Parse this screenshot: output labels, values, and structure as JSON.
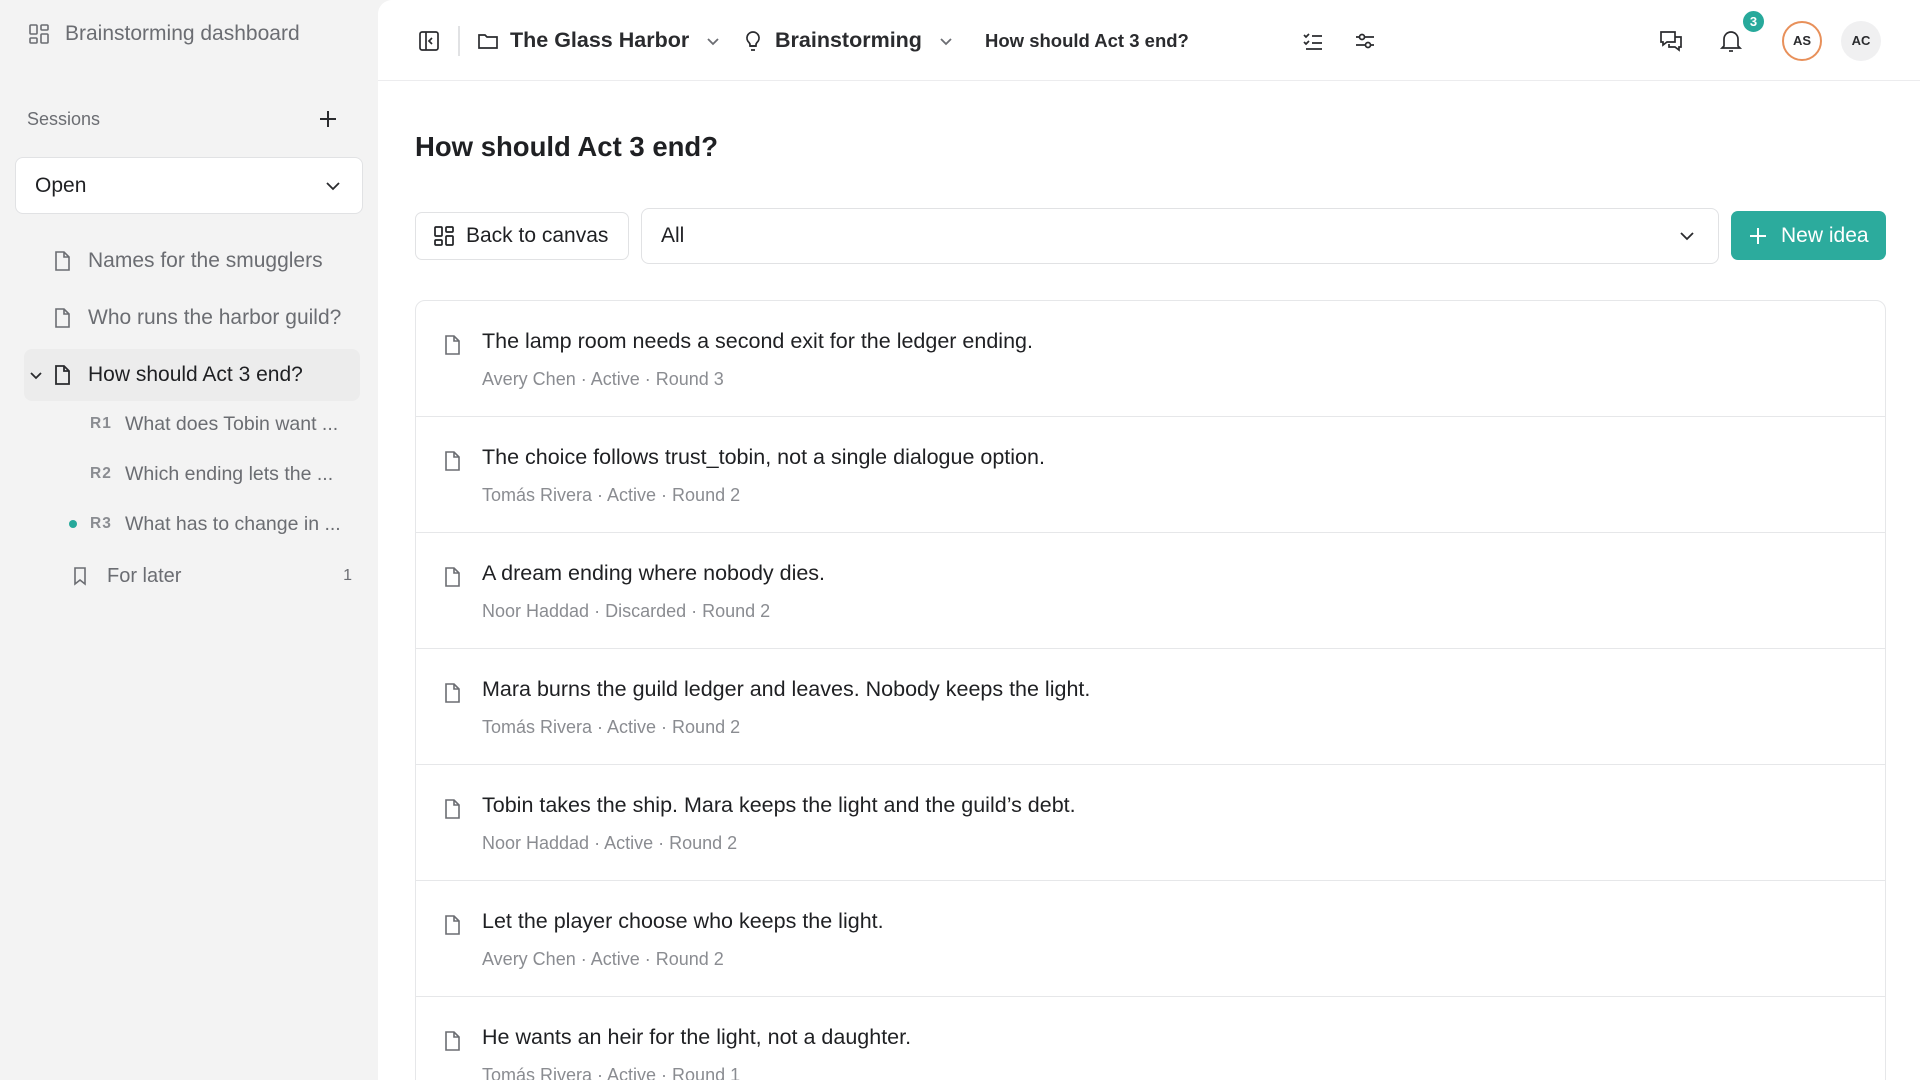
{
  "sidebar": {
    "brand": "Brainstorming dashboard",
    "sessions_label": "Sessions",
    "filter_value": "Open",
    "sessions": [
      {
        "label": "Names for the smugglers"
      },
      {
        "label": "Who runs the harbor guild?"
      },
      {
        "label": "How should Act 3 end?"
      }
    ],
    "rounds": [
      {
        "code": "R1",
        "label": "What does Tobin want ..."
      },
      {
        "code": "R2",
        "label": "Which ending lets the ..."
      },
      {
        "code": "R3",
        "label": "What has to change in ..."
      }
    ],
    "later": {
      "label": "For later",
      "count": "1"
    }
  },
  "topbar": {
    "project": "The Glass Harbor",
    "mode": "Brainstorming",
    "current": "How should Act 3 end?",
    "notification_count": "3",
    "avatars": [
      "AS",
      "AC"
    ]
  },
  "main": {
    "title": "How should Act 3 end?",
    "back_label": "Back to canvas",
    "filter_value": "All",
    "new_label": "New idea"
  },
  "ideas": [
    {
      "text": "The lamp room needs a second exit for the ledger ending.",
      "meta": "Avery Chen · Active · Round 3"
    },
    {
      "text": "The choice follows trust_tobin, not a single dialogue option.",
      "meta": "Tomás Rivera · Active · Round 2"
    },
    {
      "text": "A dream ending where nobody dies.",
      "meta": "Noor Haddad · Discarded · Round 2"
    },
    {
      "text": "Mara burns the guild ledger and leaves. Nobody keeps the light.",
      "meta": "Tomás Rivera · Active · Round 2"
    },
    {
      "text": "Tobin takes the ship. Mara keeps the light and the guild’s debt.",
      "meta": "Noor Haddad · Active · Round 2"
    },
    {
      "text": "Let the player choose who keeps the light.",
      "meta": "Avery Chen · Active · Round 2"
    },
    {
      "text": "He wants an heir for the light, not a daughter.",
      "meta": "Tomás Rivera · Active · Round 1"
    }
  ],
  "colors": {
    "accent": "#2cab9d",
    "badge": "#27a99b",
    "avatar_ring": "#e8905a"
  },
  "icons": [
    "dashboard-icon",
    "plus-icon",
    "chevron-down-icon",
    "document-icon",
    "bookmark-icon",
    "sidebar-toggle-icon",
    "folder-icon",
    "lightbulb-icon",
    "checklist-icon",
    "sliders-icon",
    "chat-icon",
    "bell-icon",
    "grid-icon"
  ]
}
